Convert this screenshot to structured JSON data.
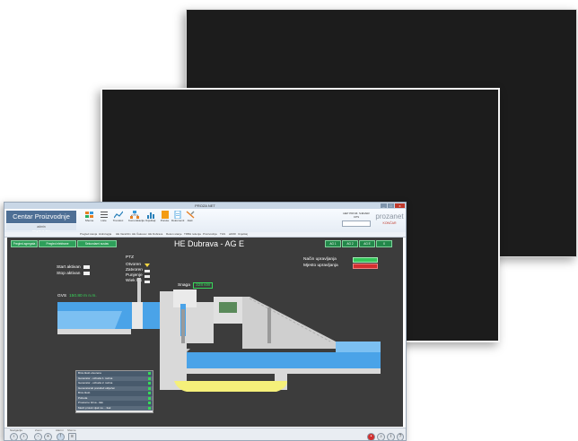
{
  "window": {
    "title": "PROZA NET"
  },
  "ribbon": {
    "brand": "Centar Proizvodnje Sjever",
    "brand_sub": "admin",
    "buttons": [
      "Sheme",
      "Liste",
      "Trendovi",
      "Komunikacija",
      "Izvještaji",
      "Poruke",
      "Dokumenti",
      "Alati"
    ],
    "user_line1": "HEP PROIZ. SJEVER",
    "user_line2": "CPS",
    "logo_top": "prozanet",
    "logo_bottom": "KONČAR"
  },
  "nav": {
    "items": [
      "Pregled stanja",
      "Hidrologija",
      "HE Varaždin",
      "HE Čakovec",
      "HE Dubrava",
      "Rekon.stanje",
      "TRBH rešenja",
      "Proizvodnja",
      "TGS",
      "aFRR",
      "Izvještaj"
    ]
  },
  "scada": {
    "title": "HE Dubrava - AG E",
    "top_left_buttons": [
      "Pregled agregata",
      "Pregled elektrane",
      "Sekundarni sustav"
    ],
    "top_right_buttons": [
      "AG 1",
      "AG 2",
      "AG E",
      "X"
    ],
    "start_label": "Start aktivan",
    "stop_label": "Stop aktivan",
    "ptz_title": "PTZ",
    "ptz_items": [
      "Otvoren",
      "Zatvoren",
      "Punjenje",
      "Wiek lbk"
    ],
    "snaga_label": "Snaga",
    "snaga_value": "328 kW",
    "gvs_label": "GVS",
    "gvs_value": "150.80 m n.m.",
    "dvs_label": "DVS",
    "dvs_value": "128.30 m n.m.",
    "mode_label": "Način upravljanja",
    "place_label": "Mjesto upravljanja",
    "status_items": [
      "Brza škob otvorena",
      "Generator - uzbuda 1. razina",
      "Generator - uzbuda 2. razina",
      "Generatorski prekidač uključen",
      "Brza škob",
      "Pobuda",
      "Prostorno brtva - tlak",
      "Mesh protok vijak na ... tlak"
    ],
    "colors": {
      "background": "#3c3c3c",
      "water": "#4aa3e8",
      "concrete": "#d9d9d9",
      "green": "#37d85a",
      "red": "#d32f2f",
      "sediment": "#f5f07a"
    }
  },
  "statusbar": {
    "groups": [
      "Navigacija",
      "Zoom",
      "Alarmi",
      "Sheme"
    ],
    "icons": [
      "back-icon",
      "forward-icon",
      "zoom-out-icon",
      "zoom-in-icon",
      "alarm-icon",
      "layers-icon",
      "speaker-icon",
      "info-icon"
    ]
  }
}
